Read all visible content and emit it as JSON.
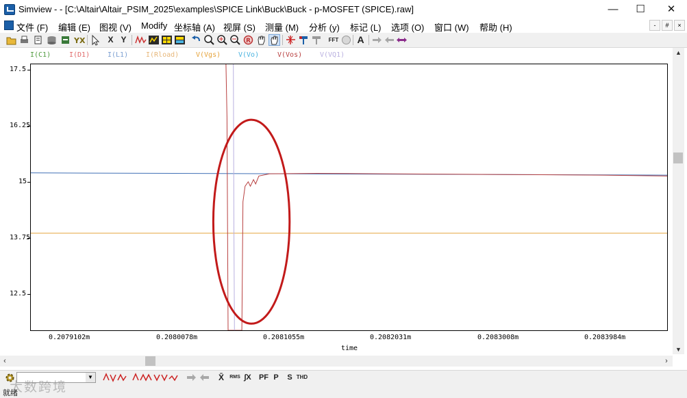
{
  "window": {
    "title": "Simview -  - [C:\\Altair\\Altair_PSIM_2025\\examples\\SPICE Link\\Buck\\Buck - p-MOSFET (SPICE).raw]",
    "minimize_glyph": "—",
    "maximize_glyph": "☐",
    "close_glyph": "✕"
  },
  "menu": {
    "items": [
      "文件 (F)",
      "编辑 (E)",
      "图视 (V)",
      "Modify",
      "坐标轴 (A)",
      "视屏 (S)",
      "测量 (M)",
      "分析 (y)",
      "标记 (L)",
      "选项 (O)",
      "窗口 (W)",
      "帮助 (H)"
    ],
    "mdi_min": "-",
    "mdi_restore": "#",
    "mdi_close": "×"
  },
  "toolbar": {
    "x_label": "X",
    "y_label": "Y",
    "fft_label": "FFT",
    "text_label": "A"
  },
  "colors": {
    "vgs": "#e5a33b",
    "vo": "#3f6fb5",
    "vos": "#b84040",
    "vq1": "#b9b0e0",
    "annotation": "#c21a1a"
  },
  "legend": {
    "items": [
      {
        "label": "I(C1)",
        "color": "#4e9a3c"
      },
      {
        "label": "I(D1)",
        "color": "#e06a6a"
      },
      {
        "label": "I(L1)",
        "color": "#7b9fd1"
      },
      {
        "label": "I(Rload)",
        "color": "#e7b77a"
      },
      {
        "label": "V(Vgs)",
        "color": "#e5a33b"
      },
      {
        "label": "V(Vo)",
        "color": "#4ab3e0"
      },
      {
        "label": "V(Vos)",
        "color": "#b84040"
      },
      {
        "label": "V(VQ1)",
        "color": "#b9b0e0"
      }
    ]
  },
  "chart_data": {
    "type": "line",
    "xlabel": "time",
    "xlim": [
      0.20785,
      0.20845
    ],
    "ylim": [
      11.7,
      17.7
    ],
    "y_ticks": [
      "17.5",
      "16.25",
      "15",
      "13.75",
      "12.5"
    ],
    "x_ticks": [
      "0.2079102m",
      "0.2080078m",
      "0.2081055m",
      "0.2082031m",
      "0.2083008m",
      "0.2083984m"
    ],
    "series": [
      {
        "name": "V(Vo)",
        "x": [
          0.20785,
          0.20845
        ],
        "values": [
          15.25,
          15.2
        ]
      },
      {
        "name": "V(Vgs)",
        "x": [
          0.20785,
          0.20845
        ],
        "values": [
          13.89,
          13.89
        ]
      },
      {
        "name": "V(Vos)",
        "x": [
          0.208034,
          0.208035,
          0.208036,
          0.208049,
          0.20805,
          0.208052,
          0.208055,
          0.208057,
          0.20806,
          0.208062,
          0.208065,
          0.208075,
          0.20812,
          0.20818,
          0.20825,
          0.20832,
          0.20839,
          0.20845
        ],
        "values": [
          17.7,
          16.5,
          11.7,
          11.7,
          14.6,
          14.95,
          15.05,
          14.95,
          15.1,
          15.0,
          15.18,
          15.23,
          15.24,
          15.23,
          15.22,
          15.21,
          15.2,
          15.18
        ]
      },
      {
        "name": "V(VQ1)",
        "x": [
          0.208041,
          0.2080415,
          0.208042
        ],
        "values": [
          17.7,
          14.0,
          11.7
        ]
      }
    ],
    "annotation": {
      "shape": "ellipse",
      "center": [
        0.208058,
        14.15
      ],
      "radius": [
        3.6e-05,
        2.3
      ]
    }
  },
  "bottom_toolbar": {
    "mean_label": "X̄",
    "rms_label": "RMS",
    "integral_label": "∫X",
    "pf_label": "PF",
    "p_label": "P",
    "s_label": "S",
    "thd_label": "THD"
  },
  "watermark": "大数跨境",
  "status": "就绪"
}
